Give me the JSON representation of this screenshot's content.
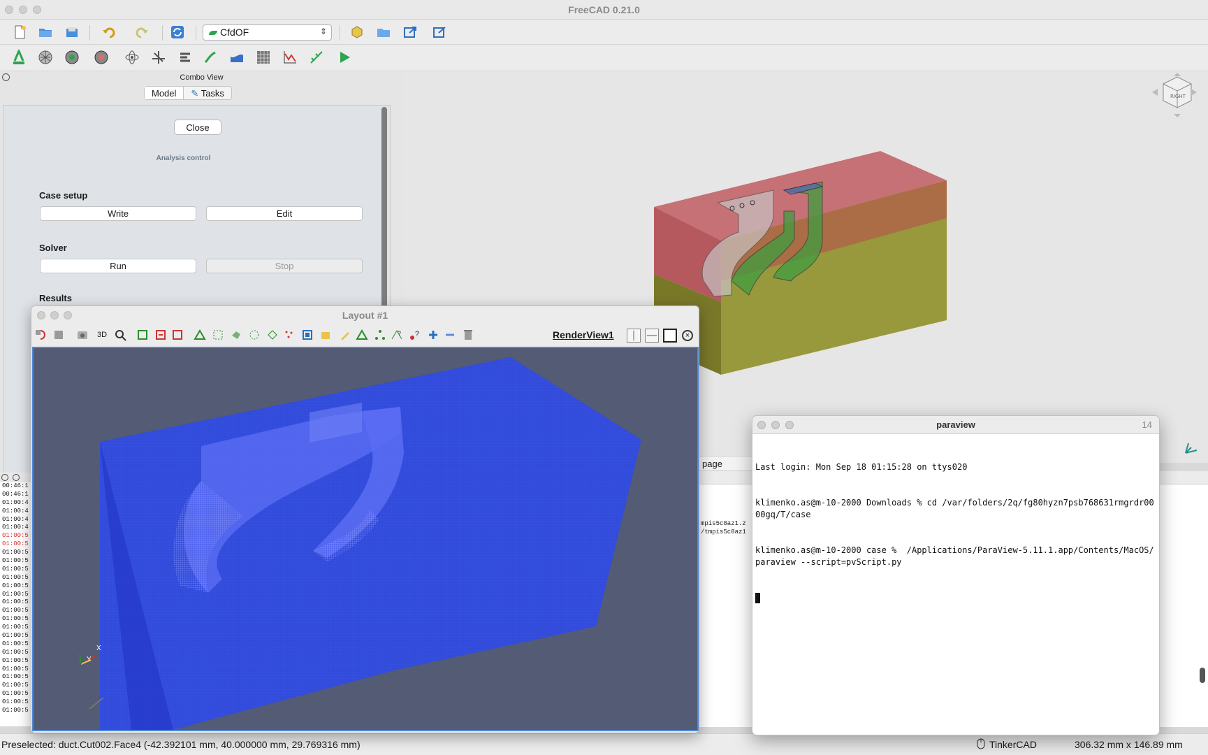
{
  "app": {
    "title": "FreeCAD 0.21.0"
  },
  "toolbar": {
    "workbench": "CfdOF",
    "icons_row1": [
      "new-file-icon",
      "open-icon",
      "save-icon",
      "undo-icon",
      "redo-icon",
      "refresh-icon"
    ],
    "icons_row2": [
      "cfd-analysis-icon",
      "fluid-material-icon",
      "initialise-icon",
      "fluid-boundary-icon",
      "physics-model-icon",
      "mesh-refinement-icon",
      "dynamic-mesh-icon",
      "zone-icon",
      "scalar-transport-icon",
      "mesh-icon",
      "report-plot-icon",
      "solver-control-icon",
      "run-solver-icon"
    ]
  },
  "combo": {
    "title": "Combo View",
    "tabs": [
      "Model",
      "Tasks"
    ],
    "close": "Close",
    "analysis_label": "Analysis control",
    "case_setup": {
      "label": "Case setup",
      "write": "Write",
      "edit": "Edit"
    },
    "solver": {
      "label": "Solver",
      "run": "Run",
      "stop": "Stop"
    },
    "results": {
      "label": "Results"
    }
  },
  "report_lines": [
    {
      "t": "00:46:1",
      "err": false
    },
    {
      "t": "00:46:1",
      "err": false
    },
    {
      "t": "01:00:4",
      "err": false
    },
    {
      "t": "01:00:4",
      "err": false
    },
    {
      "t": "01:00:4",
      "err": false
    },
    {
      "t": "01:00:4",
      "err": false
    },
    {
      "t": "01:00:5",
      "err": true
    },
    {
      "t": "01:00:5",
      "err": true
    },
    {
      "t": "01:00:5",
      "err": false
    },
    {
      "t": "01:00:5",
      "err": false
    },
    {
      "t": "01:00:5",
      "err": false
    },
    {
      "t": "01:00:5",
      "err": false
    },
    {
      "t": "01:00:5",
      "err": false
    },
    {
      "t": "01:00:5",
      "err": false
    },
    {
      "t": "01:00:5",
      "err": false
    },
    {
      "t": "01:00:5",
      "err": false
    },
    {
      "t": "01:00:5",
      "err": false
    },
    {
      "t": "01:00:5",
      "err": false
    },
    {
      "t": "01:00:5",
      "err": false
    },
    {
      "t": "01:00:5",
      "err": false
    },
    {
      "t": "01:00:5",
      "err": false
    },
    {
      "t": "01:00:5",
      "err": false
    },
    {
      "t": "01:00:5",
      "err": false
    },
    {
      "t": "01:00:5",
      "err": false
    },
    {
      "t": "01:00:5",
      "err": false
    },
    {
      "t": "01:00:5",
      "err": false
    },
    {
      "t": "01:00:5",
      "err": false
    },
    {
      "t": "01:00:5",
      "err": false
    }
  ],
  "bottom_panel": {
    "tab": "page",
    "line1": "mpis5c8az1.z",
    "line2": "/tmpis5c8az1"
  },
  "paraview": {
    "window_title": "Layout #1",
    "view_label": "RenderView1",
    "toolbar_3d": "3D",
    "axes": {
      "x": "X",
      "y": "Y"
    }
  },
  "terminal": {
    "title": "paraview",
    "badge": "14",
    "lines": [
      "Last login: Mon Sep 18 01:15:28 on ttys020",
      "klimenko.as@m-10-2000 Downloads % cd /var/folders/2q/fg80hyzn7psb768631rmgrdr0000gq/T/case",
      "klimenko.as@m-10-2000 case %  /Applications/ParaView-5.11.1.app/Contents/MacOS/paraview --script=pvScript.py"
    ]
  },
  "status": {
    "preselected": "Preselected: duct.Cut002.Face4 (-42.392101 mm, 40.000000 mm, 29.769316 mm)",
    "nav_style": "TinkerCAD",
    "dimensions": "306.32 mm x 146.89 mm"
  },
  "colors": {
    "domain_red": "#b94a4f",
    "domain_olive": "#8a8a1e",
    "duct_green": "#3f9e3f",
    "mesh_blue": "#2f49e6",
    "pv_background": "#535b75"
  }
}
